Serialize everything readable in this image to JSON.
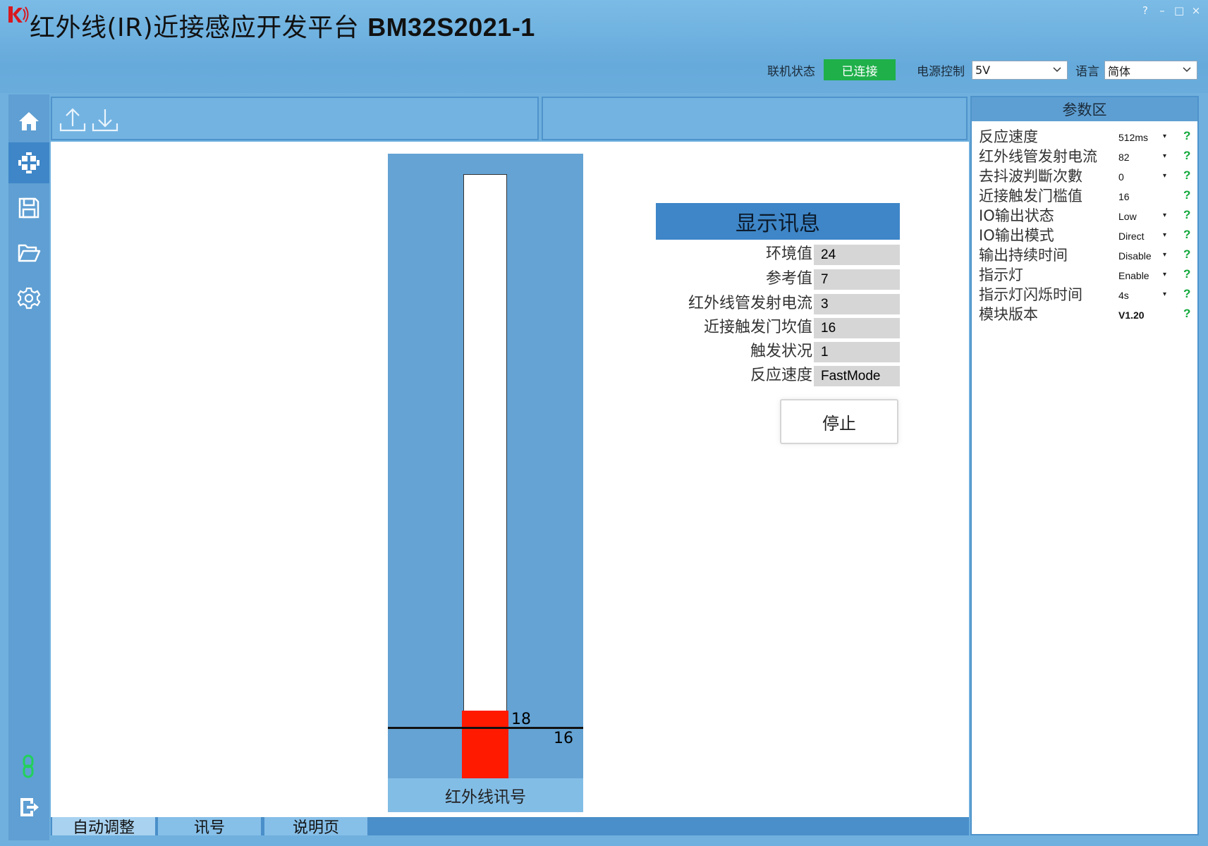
{
  "window": {
    "title_cn": "红外线(IR)近接感应开发平台",
    "title_model": "BM32S2021-1",
    "controls": [
      "?",
      "–",
      "□",
      "×"
    ]
  },
  "status": {
    "connection_label": "联机状态",
    "connection_value": "已连接",
    "power_label": "电源控制",
    "power_value": "5V",
    "language_label": "语言",
    "language_value": "简体"
  },
  "nav": [
    "home-icon",
    "modules-icon",
    "save-icon",
    "folder-open-icon",
    "gear-icon",
    "link-icon",
    "exit-icon"
  ],
  "colors": {
    "connected": "#1fb04a",
    "gauge_fill": "#ff1a00",
    "help": "#11a83a",
    "accent": "#3e86c7"
  },
  "gauge": {
    "label": "红外线讯号",
    "signal_value": "18",
    "threshold_value": "16",
    "signal": 18,
    "threshold": 16,
    "max": 150
  },
  "info": {
    "title": "显示讯息",
    "rows": [
      {
        "label": "环境值",
        "value": "24"
      },
      {
        "label": "参考值",
        "value": "7"
      },
      {
        "label": "红外线管发射电流",
        "value": "3"
      },
      {
        "label": "近接触发门坎值",
        "value": "16"
      },
      {
        "label": "触发状况",
        "value": "1"
      },
      {
        "label": "反应速度",
        "value": "FastMode"
      }
    ],
    "stop_label": "停止"
  },
  "tabs": [
    {
      "label": "自动调整",
      "active": true
    },
    {
      "label": "讯号",
      "active": false
    },
    {
      "label": "说明页",
      "active": false
    }
  ],
  "params": {
    "title": "参数区",
    "rows": [
      {
        "label": "反应速度",
        "value": "512ms",
        "dropdown": true
      },
      {
        "label": "红外线管发射电流",
        "value": "82",
        "dropdown": true
      },
      {
        "label": "去抖波判斷次數",
        "value": "0",
        "dropdown": true
      },
      {
        "label": "近接触发门槛值",
        "value": "16",
        "dropdown": false
      },
      {
        "label": "IO输出状态",
        "value": "Low",
        "dropdown": true
      },
      {
        "label": "IO输出模式",
        "value": "Direct",
        "dropdown": true
      },
      {
        "label": "输出持续时间",
        "value": "Disable",
        "dropdown": true
      },
      {
        "label": "指示灯",
        "value": "Enable",
        "dropdown": true
      },
      {
        "label": "指示灯闪烁时间",
        "value": "4s",
        "dropdown": true
      },
      {
        "label": "模块版本",
        "value": "V1.20",
        "dropdown": false
      }
    ],
    "help_glyph": "?",
    "dropdown_glyph": "▾"
  }
}
